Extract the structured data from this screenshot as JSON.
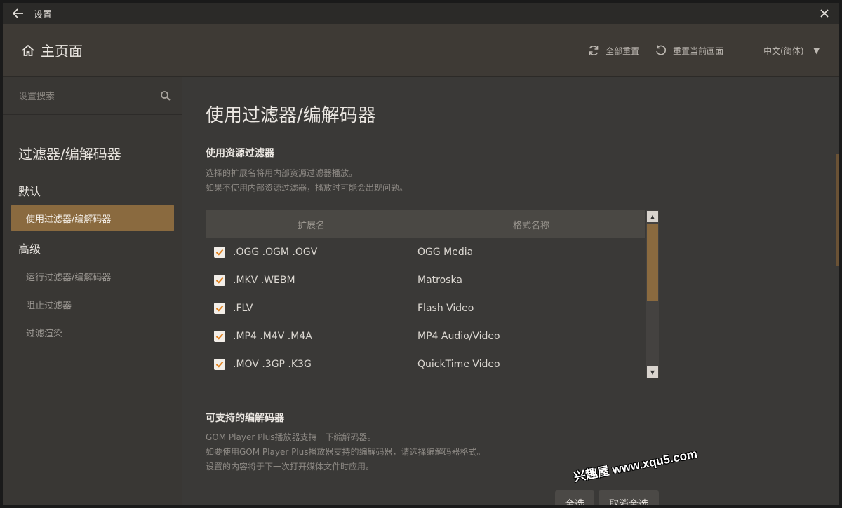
{
  "window": {
    "title": "设置"
  },
  "header": {
    "home_label": "主页面",
    "reset_all": "全部重置",
    "reset_current": "重置当前画面",
    "language": "中文(简体)"
  },
  "sidebar": {
    "search_placeholder": "设置搜索",
    "category_title": "过滤器/编解码器",
    "group_default": "默认",
    "group_advanced": "高级",
    "items": [
      {
        "label": "使用过滤器/编解码器",
        "active": true
      },
      {
        "label": "运行过滤器/编解码器",
        "active": false
      },
      {
        "label": "阻止过滤器",
        "active": false
      },
      {
        "label": "过滤渲染",
        "active": false
      }
    ]
  },
  "main": {
    "page_title": "使用过滤器/编解码器",
    "source_filter": {
      "title": "使用资源过滤器",
      "desc_line1": "选择的扩展名将用内部资源过滤器播放。",
      "desc_line2": "如果不使用内部资源过滤器，播放时可能会出现问题。"
    },
    "table": {
      "col_ext": "扩展名",
      "col_format": "格式名称",
      "rows": [
        {
          "ext": ".OGG .OGM .OGV",
          "format": "OGG Media",
          "checked": true
        },
        {
          "ext": ".MKV .WEBM",
          "format": "Matroska",
          "checked": true
        },
        {
          "ext": ".FLV",
          "format": "Flash Video",
          "checked": true
        },
        {
          "ext": ".MP4 .M4V .M4A",
          "format": "MP4 Audio/Video",
          "checked": true
        },
        {
          "ext": ".MOV .3GP .K3G",
          "format": "QuickTime Video",
          "checked": true
        }
      ]
    },
    "codecs": {
      "title": "可支持的编解码器",
      "desc_line1": "GOM Player Plus播放器支持一下编解码器。",
      "desc_line2": "如要使用GOM Player Plus播放器支持的编解码器，请选择编解码器格式。",
      "desc_line3": "设置的内容将于下一次打开媒体文件时应用。"
    },
    "select_all": "全选",
    "deselect_all": "取消全选"
  },
  "watermark": "兴趣屋 www.xqu5.com",
  "colors": {
    "accent": "#8a6a3f",
    "background": "#3a3937",
    "header": "#3e3a35"
  }
}
